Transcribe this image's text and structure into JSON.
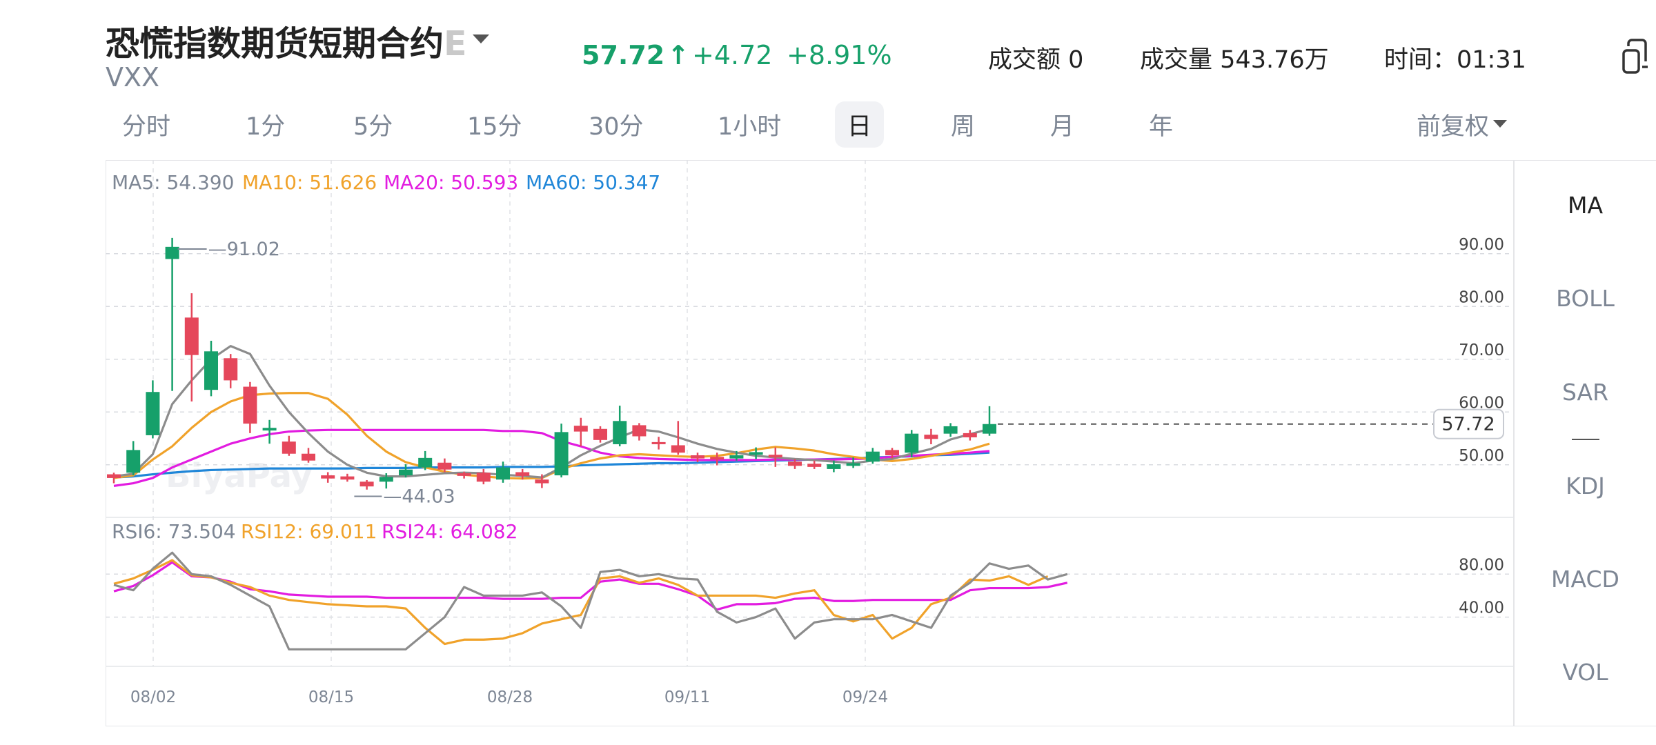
{
  "header": {
    "title_main": "恐慌指数期货短期合约",
    "title_fade": "E",
    "symbol": "VXX",
    "price": "57.72",
    "arrow": "↑",
    "change": "+4.72",
    "change_pct": "+8.91%",
    "turnover_label": "成交额",
    "turnover_value": "0",
    "volume_label": "成交量",
    "volume_value": "543.76万",
    "time_label": "时间：",
    "time_value": "01:31"
  },
  "tabs": [
    {
      "label": "分时"
    },
    {
      "label": "1分"
    },
    {
      "label": "5分"
    },
    {
      "label": "15分"
    },
    {
      "label": "30分"
    },
    {
      "label": "1小时"
    },
    {
      "label": "日"
    },
    {
      "label": "周"
    },
    {
      "label": "月"
    },
    {
      "label": "年"
    }
  ],
  "active_tab": "日",
  "adjust": "前复权",
  "indicators": [
    {
      "label": "MA"
    },
    {
      "label": "BOLL"
    },
    {
      "label": "SAR"
    },
    {
      "label": "KDJ"
    },
    {
      "label": "MACD"
    },
    {
      "label": "VOL"
    }
  ],
  "active_indicator": "MA",
  "watermark": "BiyaPay",
  "colors": {
    "up": "#16a06a",
    "down": "#e5475b",
    "ma5": "#8c8c8c",
    "ma10": "#f0a22a",
    "ma20": "#e21ce0",
    "ma60": "#1f86d8"
  },
  "chart_data": [
    {
      "type": "candlestick",
      "legend": [
        {
          "name": "MA5",
          "value": "54.390"
        },
        {
          "name": "MA10",
          "value": "51.626"
        },
        {
          "name": "MA20",
          "value": "50.593"
        },
        {
          "name": "MA60",
          "value": "50.347"
        }
      ],
      "y_ticks": [
        "90.00",
        "80.00",
        "70.00",
        "60.00",
        "50.00"
      ],
      "ylim": [
        40.3,
        98.6
      ],
      "x_ticks": [
        "08/02",
        "08/15",
        "08/28",
        "09/11",
        "09/24"
      ],
      "high_label": "91.02",
      "low_label": "44.03",
      "last_price_label": "57.72",
      "candles": [
        {
          "o": 48.2,
          "c": 47.5,
          "h": 48.5,
          "l": 46.5
        },
        {
          "o": 48.5,
          "c": 52.8,
          "h": 54.5,
          "l": 48.0
        },
        {
          "o": 55.6,
          "c": 63.8,
          "h": 66.0,
          "l": 55.0
        },
        {
          "o": 89.0,
          "c": 91.3,
          "h": 93.0,
          "l": 64.0
        },
        {
          "o": 77.9,
          "c": 70.8,
          "h": 82.5,
          "l": 62.0
        },
        {
          "o": 64.2,
          "c": 71.5,
          "h": 73.5,
          "l": 63.0
        },
        {
          "o": 70.2,
          "c": 66.0,
          "h": 71.0,
          "l": 64.5
        },
        {
          "o": 64.8,
          "c": 57.8,
          "h": 65.7,
          "l": 56.0
        },
        {
          "o": 56.5,
          "c": 57.0,
          "h": 58.5,
          "l": 54.0
        },
        {
          "o": 54.4,
          "c": 52.1,
          "h": 55.5,
          "l": 51.7
        },
        {
          "o": 52.1,
          "c": 50.8,
          "h": 53.2,
          "l": 50.4
        },
        {
          "o": 48.0,
          "c": 47.4,
          "h": 48.6,
          "l": 46.6
        },
        {
          "o": 47.8,
          "c": 47.2,
          "h": 48.3,
          "l": 46.8
        },
        {
          "o": 46.8,
          "c": 45.9,
          "h": 47.1,
          "l": 45.3
        },
        {
          "o": 46.8,
          "c": 47.7,
          "h": 48.4,
          "l": 45.5
        },
        {
          "o": 48.0,
          "c": 49.1,
          "h": 50.1,
          "l": 47.6
        },
        {
          "o": 49.5,
          "c": 51.3,
          "h": 52.6,
          "l": 49.0
        },
        {
          "o": 50.4,
          "c": 49.1,
          "h": 51.2,
          "l": 48.6
        },
        {
          "o": 48.4,
          "c": 47.9,
          "h": 48.7,
          "l": 47.4
        },
        {
          "o": 48.5,
          "c": 46.8,
          "h": 49.2,
          "l": 46.3
        },
        {
          "o": 47.2,
          "c": 49.5,
          "h": 50.6,
          "l": 46.6
        },
        {
          "o": 48.6,
          "c": 47.9,
          "h": 49.2,
          "l": 47.2
        },
        {
          "o": 47.2,
          "c": 46.5,
          "h": 48.2,
          "l": 45.6
        },
        {
          "o": 48.0,
          "c": 56.2,
          "h": 57.8,
          "l": 47.6
        },
        {
          "o": 57.4,
          "c": 56.3,
          "h": 58.9,
          "l": 53.5
        },
        {
          "o": 56.8,
          "c": 54.7,
          "h": 57.3,
          "l": 54.2
        },
        {
          "o": 53.9,
          "c": 58.3,
          "h": 61.2,
          "l": 53.5
        },
        {
          "o": 57.5,
          "c": 55.4,
          "h": 57.9,
          "l": 54.6
        },
        {
          "o": 54.3,
          "c": 53.9,
          "h": 55.3,
          "l": 52.9
        },
        {
          "o": 53.7,
          "c": 52.3,
          "h": 58.3,
          "l": 51.9
        },
        {
          "o": 51.8,
          "c": 51.2,
          "h": 52.3,
          "l": 50.5
        },
        {
          "o": 51.5,
          "c": 51.0,
          "h": 52.3,
          "l": 49.9
        },
        {
          "o": 51.2,
          "c": 51.8,
          "h": 52.6,
          "l": 50.8
        },
        {
          "o": 51.9,
          "c": 52.4,
          "h": 53.3,
          "l": 51.1
        },
        {
          "o": 51.9,
          "c": 51.4,
          "h": 53.3,
          "l": 49.6
        },
        {
          "o": 50.6,
          "c": 49.8,
          "h": 51.1,
          "l": 49.2
        },
        {
          "o": 50.2,
          "c": 49.6,
          "h": 50.8,
          "l": 49.2
        },
        {
          "o": 49.2,
          "c": 50.1,
          "h": 50.8,
          "l": 48.6
        },
        {
          "o": 49.8,
          "c": 50.3,
          "h": 51.4,
          "l": 49.4
        },
        {
          "o": 50.6,
          "c": 52.5,
          "h": 53.2,
          "l": 50.2
        },
        {
          "o": 52.8,
          "c": 51.8,
          "h": 53.2,
          "l": 51.2
        },
        {
          "o": 52.3,
          "c": 55.9,
          "h": 56.6,
          "l": 51.4
        },
        {
          "o": 55.7,
          "c": 54.9,
          "h": 56.8,
          "l": 53.9
        },
        {
          "o": 55.9,
          "c": 57.3,
          "h": 57.9,
          "l": 55.3
        },
        {
          "o": 56.0,
          "c": 55.2,
          "h": 56.6,
          "l": 54.6
        },
        {
          "o": 55.9,
          "c": 57.72,
          "h": 61.1,
          "l": 55.5
        }
      ],
      "ma5": [
        47.8,
        48.3,
        52.0,
        61.5,
        66.0,
        70.0,
        72.5,
        71.0,
        65.0,
        60.0,
        56.0,
        52.5,
        50.0,
        48.5,
        47.8,
        47.8,
        48.1,
        48.4,
        48.5,
        48.4,
        48.1,
        47.9,
        47.6,
        49.5,
        51.8,
        53.6,
        55.2,
        56.7,
        56.3,
        55.2,
        54.0,
        53.0,
        52.3,
        51.7,
        51.4,
        51.1,
        50.9,
        50.6,
        50.3,
        50.8,
        51.1,
        52.1,
        53.0,
        54.8,
        55.8,
        56.8
      ],
      "ma10": [
        47.5,
        48.0,
        51.0,
        53.5,
        57.0,
        60.0,
        62.0,
        63.2,
        63.5,
        63.6,
        63.6,
        62.5,
        59.5,
        55.5,
        52.5,
        50.5,
        49.5,
        48.7,
        48.1,
        47.8,
        47.5,
        47.4,
        47.5,
        49.2,
        50.3,
        51.2,
        51.8,
        52.0,
        51.8,
        51.6,
        51.5,
        51.7,
        52.2,
        52.9,
        53.4,
        53.1,
        52.7,
        52.0,
        51.5,
        51.0,
        50.7,
        51.1,
        51.7,
        52.3,
        52.9,
        54.0
      ],
      "ma20": [
        46.0,
        46.5,
        47.5,
        49.5,
        51.0,
        52.5,
        54.0,
        55.0,
        55.8,
        56.3,
        56.5,
        56.6,
        56.6,
        56.6,
        56.6,
        56.6,
        56.6,
        56.6,
        56.6,
        56.6,
        56.4,
        56.4,
        56.0,
        54.5,
        53.5,
        52.3,
        51.6,
        51.3,
        51.1,
        51.0,
        50.9,
        50.9,
        50.9,
        50.9,
        51.0,
        51.0,
        51.0,
        51.0,
        51.1,
        51.2,
        51.5,
        51.7,
        51.9,
        52.1,
        52.3,
        52.6
      ],
      "ma60": [
        47.6,
        47.8,
        48.2,
        48.5,
        48.8,
        49.0,
        49.1,
        49.2,
        49.3,
        49.3,
        49.3,
        49.3,
        49.3,
        49.4,
        49.4,
        49.4,
        49.5,
        49.5,
        49.5,
        49.5,
        49.6,
        49.6,
        49.6,
        49.7,
        49.9,
        50.0,
        50.1,
        50.2,
        50.3,
        50.3,
        50.4,
        50.5,
        50.6,
        50.7,
        50.8,
        50.9,
        51.0,
        51.1,
        51.2,
        51.4,
        51.5,
        51.6,
        51.8,
        51.9,
        52.1,
        52.3
      ]
    },
    {
      "type": "line",
      "legend": [
        {
          "name": "RSI6",
          "value": "73.504"
        },
        {
          "name": "RSI12",
          "value": "69.011"
        },
        {
          "name": "RSI24",
          "value": "64.082"
        }
      ],
      "y_ticks": [
        "80.00",
        "40.00"
      ],
      "ylim": [
        -3.3,
        113.6
      ],
      "rsi6": [
        70,
        65,
        85,
        100,
        80,
        78,
        70,
        60,
        50,
        10,
        10,
        10,
        10,
        10,
        10,
        10,
        25,
        40,
        68,
        60,
        60,
        60,
        63,
        50,
        30,
        82,
        84,
        78,
        80,
        76,
        75,
        45,
        35,
        40,
        48,
        20,
        35,
        38,
        38,
        38,
        42,
        36,
        30,
        60,
        72,
        90,
        85,
        88,
        75,
        80
      ],
      "rsi12": [
        71,
        76,
        84,
        93,
        79,
        77,
        72,
        68,
        60,
        56,
        54,
        52,
        51,
        50,
        50,
        48,
        30,
        15,
        19,
        19,
        20,
        25,
        34,
        38,
        42,
        76,
        78,
        72,
        76,
        70,
        60,
        60,
        60,
        60,
        58,
        62,
        65,
        42,
        36,
        42,
        20,
        30,
        52,
        58,
        75,
        74,
        78,
        70,
        78
      ],
      "rsi24": [
        64,
        69,
        79,
        91,
        78,
        77,
        73,
        66,
        64,
        61,
        60,
        59,
        59,
        59,
        58,
        58,
        58,
        58,
        58,
        58,
        57,
        57,
        57,
        58,
        58,
        73,
        75,
        71,
        71,
        66,
        60,
        47,
        52,
        52,
        53,
        57,
        58,
        55,
        55,
        56,
        56,
        56,
        56,
        56,
        65,
        67,
        67,
        67,
        68,
        72
      ]
    }
  ]
}
